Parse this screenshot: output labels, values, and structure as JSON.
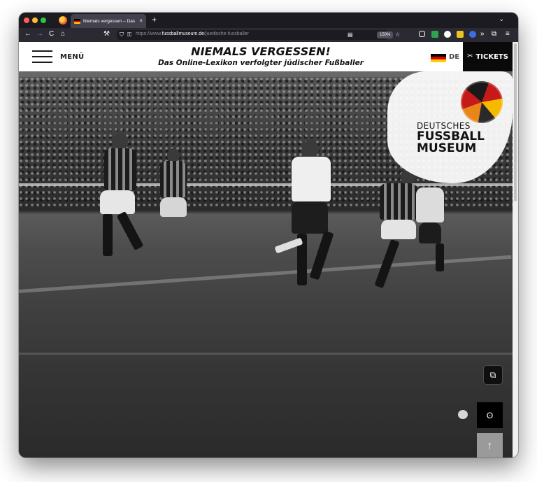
{
  "browser": {
    "tab": {
      "title": "Niemals vergessen – Das Onlin",
      "close": "×"
    },
    "new_tab": "+",
    "tab_list": "⌄",
    "nav": {
      "back": "←",
      "forward": "→",
      "reload": "C",
      "home": "⌂",
      "tools": "⚒"
    },
    "url": {
      "prefix": "https://www.",
      "domain": "fussballmuseum.de",
      "path": "/juedische-fussballer"
    },
    "zoom": "150%",
    "colors": {
      "tab_bg": "#42414d",
      "toolbar_bg": "#2b2a33",
      "urlbar_bg": "#1c1b22"
    }
  },
  "header": {
    "menu_label": "MENÜ",
    "title": "NIEMALS VERGESSEN!",
    "subtitle": "Das Online-Lexikon verfolgter jüdischer Fußballer",
    "language": "DE",
    "tickets_label": "TICKETS"
  },
  "badge": {
    "line1": "DEUTSCHES",
    "line2": "FUSSBALL",
    "line3": "MUSEUM"
  },
  "icons": {
    "pip": "⧉",
    "fingerprint": "ʘ",
    "back_to_top": "↑",
    "ticket": "✂"
  },
  "colors": {
    "tickets_bg": "#0a0a0a",
    "flag": [
      "#000000",
      "#dd0000",
      "#ffce00"
    ],
    "top_button_bg": "#9a9a9a"
  }
}
